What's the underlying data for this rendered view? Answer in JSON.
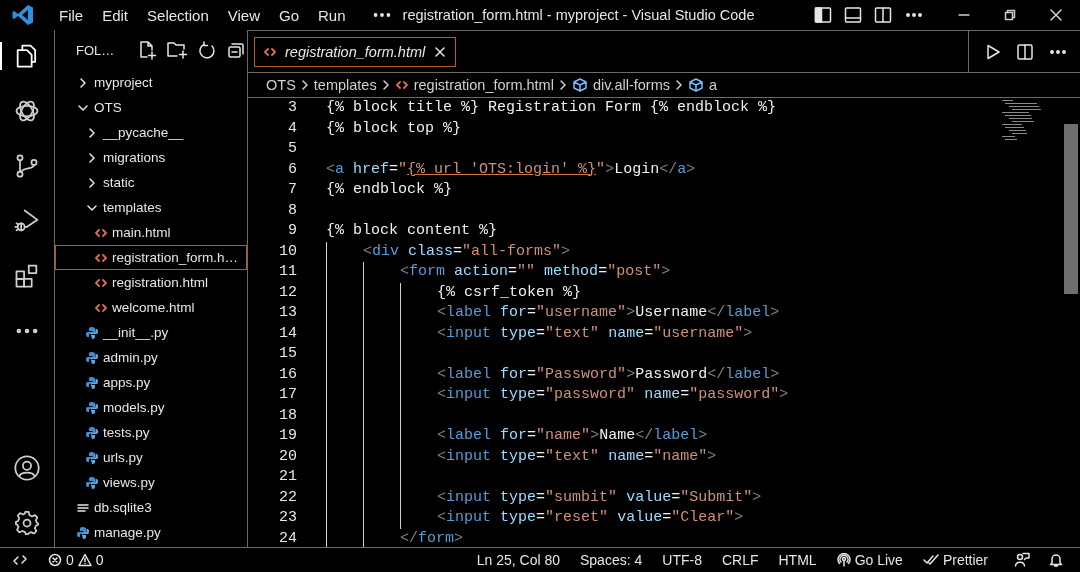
{
  "window": {
    "title": "registration_form.html - myproject - Visual Studio Code"
  },
  "menu": [
    "File",
    "Edit",
    "Selection",
    "View",
    "Go",
    "Run"
  ],
  "activity_bar": [
    {
      "kind": "explorer",
      "selected": true
    },
    {
      "kind": "swirl",
      "selected": false
    },
    {
      "kind": "source",
      "selected": false
    },
    {
      "kind": "debug",
      "selected": false
    },
    {
      "kind": "extensions",
      "selected": false
    },
    {
      "kind": "more",
      "selected": false
    },
    {
      "kind": "account",
      "selected": false
    },
    {
      "kind": "settings",
      "selected": false
    }
  ],
  "sidebar": {
    "title": "FOL…",
    "items": [
      {
        "label": "myproject",
        "kind": "folder",
        "expanded": false,
        "selected": false
      },
      {
        "label": "OTS",
        "kind": "folder",
        "expanded": true,
        "selected": false,
        "children": [
          {
            "label": "__pycache__",
            "kind": "folder",
            "expanded": false,
            "selected": false
          },
          {
            "label": "migrations",
            "kind": "folder",
            "expanded": false,
            "selected": false
          },
          {
            "label": "static",
            "kind": "folder",
            "expanded": false,
            "selected": false
          },
          {
            "label": "templates",
            "kind": "folder",
            "expanded": true,
            "selected": false,
            "children": [
              {
                "label": "main.html",
                "kind": "html",
                "selected": false
              },
              {
                "label": "registration_form.h…",
                "kind": "html",
                "selected": true
              },
              {
                "label": "registration.html",
                "kind": "html",
                "selected": false
              },
              {
                "label": "welcome.html",
                "kind": "html",
                "selected": false
              }
            ]
          },
          {
            "label": "__init__.py",
            "kind": "python",
            "selected": false
          },
          {
            "label": "admin.py",
            "kind": "python",
            "selected": false
          },
          {
            "label": "apps.py",
            "kind": "python",
            "selected": false
          },
          {
            "label": "models.py",
            "kind": "python",
            "selected": false
          },
          {
            "label": "tests.py",
            "kind": "python",
            "selected": false
          },
          {
            "label": "urls.py",
            "kind": "python",
            "selected": false
          },
          {
            "label": "views.py",
            "kind": "python",
            "selected": false
          }
        ]
      },
      {
        "label": "db.sqlite3",
        "kind": "text",
        "selected": false
      },
      {
        "label": "manage.py",
        "kind": "python",
        "selected": false
      }
    ]
  },
  "tabs": [
    {
      "label": "registration_form.html",
      "selected": true,
      "preview": true
    }
  ],
  "breadcrumbs": [
    {
      "label": "OTS",
      "kind": "folder"
    },
    {
      "label": "templates",
      "kind": "folder"
    },
    {
      "label": "registration_form.html",
      "kind": "html"
    },
    {
      "label": "div.all-forms",
      "kind": "symbol"
    },
    {
      "label": "a",
      "kind": "symbol"
    }
  ],
  "editor": {
    "lines": [
      {
        "number": "3",
        "tokens": [
          {
            "kind": "template",
            "text": "{% block title %} Registration Form {% endblock %}"
          }
        ]
      },
      {
        "number": "4",
        "tokens": [
          {
            "kind": "template",
            "text": "{% block top %}"
          }
        ]
      },
      {
        "number": "5"
      },
      {
        "number": "6",
        "tokens": [
          {
            "kind": "bracket",
            "text": "<"
          },
          {
            "kind": "tag",
            "text": "a"
          },
          {
            "kind": "attr",
            "text": " href"
          },
          {
            "kind": "text",
            "text": "="
          },
          {
            "kind": "string",
            "text": "\""
          },
          {
            "kind": "link",
            "text": "{% url 'OTS:login' %}"
          },
          {
            "kind": "string",
            "text": "\""
          },
          {
            "kind": "bracket",
            "text": ">"
          },
          {
            "kind": "text",
            "text": "Login"
          },
          {
            "kind": "bracket",
            "text": "</"
          },
          {
            "kind": "tag",
            "text": "a"
          },
          {
            "kind": "bracket",
            "text": ">"
          }
        ]
      },
      {
        "number": "7",
        "tokens": [
          {
            "kind": "template",
            "text": "{% endblock %}"
          }
        ]
      },
      {
        "number": "8"
      },
      {
        "number": "9",
        "tokens": [
          {
            "kind": "template",
            "text": "{% block content %}"
          }
        ]
      },
      {
        "number": "10",
        "tokens": [
          {
            "kind": "bracket",
            "text": "    <"
          },
          {
            "kind": "tag",
            "text": "div"
          },
          {
            "kind": "attr",
            "text": " class"
          },
          {
            "kind": "text",
            "text": "="
          },
          {
            "kind": "string",
            "text": "\"all-forms\""
          },
          {
            "kind": "bracket",
            "text": ">"
          }
        ]
      },
      {
        "number": "11",
        "tokens": [
          {
            "kind": "bracket",
            "text": "        <"
          },
          {
            "kind": "tag",
            "text": "form"
          },
          {
            "kind": "attr",
            "text": " action"
          },
          {
            "kind": "text",
            "text": "="
          },
          {
            "kind": "string",
            "text": "\"\""
          },
          {
            "kind": "attr",
            "text": " method"
          },
          {
            "kind": "text",
            "text": "="
          },
          {
            "kind": "string",
            "text": "\"post\""
          },
          {
            "kind": "bracket",
            "text": ">"
          }
        ]
      },
      {
        "number": "12",
        "tokens": [
          {
            "kind": "template",
            "text": "            {% csrf_token %}"
          }
        ]
      },
      {
        "number": "13",
        "tokens": [
          {
            "kind": "bracket",
            "text": "            <"
          },
          {
            "kind": "tag",
            "text": "label"
          },
          {
            "kind": "attr",
            "text": " for"
          },
          {
            "kind": "text",
            "text": "="
          },
          {
            "kind": "string",
            "text": "\"username\""
          },
          {
            "kind": "bracket",
            "text": ">"
          },
          {
            "kind": "text",
            "text": "Username"
          },
          {
            "kind": "bracket",
            "text": "</"
          },
          {
            "kind": "tag",
            "text": "label"
          },
          {
            "kind": "bracket",
            "text": ">"
          }
        ]
      },
      {
        "number": "14",
        "tokens": [
          {
            "kind": "bracket",
            "text": "            <"
          },
          {
            "kind": "tag",
            "text": "input"
          },
          {
            "kind": "attr",
            "text": " type"
          },
          {
            "kind": "text",
            "text": "="
          },
          {
            "kind": "string",
            "text": "\"text\""
          },
          {
            "kind": "attr",
            "text": " name"
          },
          {
            "kind": "text",
            "text": "="
          },
          {
            "kind": "string",
            "text": "\"username\""
          },
          {
            "kind": "bracket",
            "text": ">"
          }
        ]
      },
      {
        "number": "15"
      },
      {
        "number": "16",
        "tokens": [
          {
            "kind": "bracket",
            "text": "            <"
          },
          {
            "kind": "tag",
            "text": "label"
          },
          {
            "kind": "attr",
            "text": " for"
          },
          {
            "kind": "text",
            "text": "="
          },
          {
            "kind": "string",
            "text": "\"Password\""
          },
          {
            "kind": "bracket",
            "text": ">"
          },
          {
            "kind": "text",
            "text": "Password"
          },
          {
            "kind": "bracket",
            "text": "</"
          },
          {
            "kind": "tag",
            "text": "label"
          },
          {
            "kind": "bracket",
            "text": ">"
          }
        ]
      },
      {
        "number": "17",
        "tokens": [
          {
            "kind": "bracket",
            "text": "            <"
          },
          {
            "kind": "tag",
            "text": "input"
          },
          {
            "kind": "attr",
            "text": " type"
          },
          {
            "kind": "text",
            "text": "="
          },
          {
            "kind": "string",
            "text": "\"password\""
          },
          {
            "kind": "attr",
            "text": " name"
          },
          {
            "kind": "text",
            "text": "="
          },
          {
            "kind": "string",
            "text": "\"password\""
          },
          {
            "kind": "bracket",
            "text": ">"
          }
        ]
      },
      {
        "number": "18"
      },
      {
        "number": "19",
        "tokens": [
          {
            "kind": "bracket",
            "text": "            <"
          },
          {
            "kind": "tag",
            "text": "label"
          },
          {
            "kind": "attr",
            "text": " for"
          },
          {
            "kind": "text",
            "text": "="
          },
          {
            "kind": "string",
            "text": "\"name\""
          },
          {
            "kind": "bracket",
            "text": ">"
          },
          {
            "kind": "text",
            "text": "Name"
          },
          {
            "kind": "bracket",
            "text": "</"
          },
          {
            "kind": "tag",
            "text": "label"
          },
          {
            "kind": "bracket",
            "text": ">"
          }
        ]
      },
      {
        "number": "20",
        "tokens": [
          {
            "kind": "bracket",
            "text": "            <"
          },
          {
            "kind": "tag",
            "text": "input"
          },
          {
            "kind": "attr",
            "text": " type"
          },
          {
            "kind": "text",
            "text": "="
          },
          {
            "kind": "string",
            "text": "\"text\""
          },
          {
            "kind": "attr",
            "text": " name"
          },
          {
            "kind": "text",
            "text": "="
          },
          {
            "kind": "string",
            "text": "\"name\""
          },
          {
            "kind": "bracket",
            "text": ">"
          }
        ]
      },
      {
        "number": "21"
      },
      {
        "number": "22",
        "tokens": [
          {
            "kind": "bracket",
            "text": "            <"
          },
          {
            "kind": "tag",
            "text": "input"
          },
          {
            "kind": "attr",
            "text": " type"
          },
          {
            "kind": "text",
            "text": "="
          },
          {
            "kind": "string",
            "text": "\"sumbit\""
          },
          {
            "kind": "attr",
            "text": " value"
          },
          {
            "kind": "text",
            "text": "="
          },
          {
            "kind": "string",
            "text": "\"Submit\""
          },
          {
            "kind": "bracket",
            "text": ">"
          }
        ]
      },
      {
        "number": "23",
        "tokens": [
          {
            "kind": "bracket",
            "text": "            <"
          },
          {
            "kind": "tag",
            "text": "input"
          },
          {
            "kind": "attr",
            "text": " type"
          },
          {
            "kind": "text",
            "text": "="
          },
          {
            "kind": "string",
            "text": "\"reset\""
          },
          {
            "kind": "attr",
            "text": " value"
          },
          {
            "kind": "text",
            "text": "="
          },
          {
            "kind": "string",
            "text": "\"Clear\""
          },
          {
            "kind": "bracket",
            "text": ">"
          }
        ]
      },
      {
        "number": "24",
        "tokens": [
          {
            "kind": "bracket",
            "text": "        </"
          },
          {
            "kind": "tag",
            "text": "form"
          },
          {
            "kind": "bracket",
            "text": ">"
          }
        ]
      }
    ]
  },
  "status_bar": {
    "errors": "0",
    "warnings": "0",
    "items": [
      {
        "kind": "plain",
        "text": "Ln 25, Col 80"
      },
      {
        "kind": "plain",
        "text": "Spaces: 4"
      },
      {
        "kind": "plain",
        "text": "UTF-8"
      },
      {
        "kind": "plain",
        "text": "CRLF"
      },
      {
        "kind": "plain",
        "text": "HTML"
      },
      {
        "kind": "broadcast",
        "text": "Go Live"
      },
      {
        "kind": "check",
        "text": "Prettier"
      }
    ]
  }
}
